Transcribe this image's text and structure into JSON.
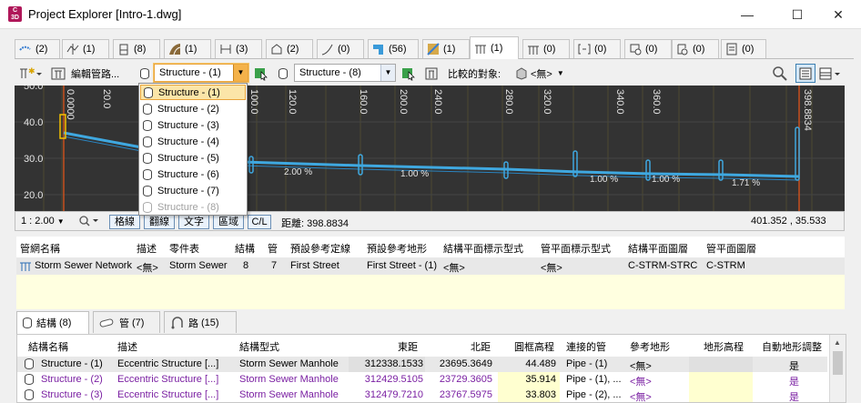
{
  "window": {
    "title": "Project Explorer [Intro-1.dwg]",
    "icon_text": "C3D"
  },
  "tabs": [
    {
      "count": "(2)",
      "icon": "alignment-icon"
    },
    {
      "count": "(1)",
      "icon": "profile-icon"
    },
    {
      "count": "(8)",
      "icon": "profile-view-icon"
    },
    {
      "count": "(1)",
      "icon": "corridor-icon"
    },
    {
      "count": "(3)",
      "icon": "sample-line-icon"
    },
    {
      "count": "(2)",
      "icon": "parcel-icon"
    },
    {
      "count": "(0)",
      "icon": "feature-line-icon"
    },
    {
      "count": "(56)",
      "icon": "pipe-icon"
    },
    {
      "count": "(1)",
      "icon": "surface-icon"
    },
    {
      "count": "(1)",
      "icon": "pipe-network-icon"
    },
    {
      "count": "(0)",
      "icon": "pressure-network-icon"
    },
    {
      "count": "(0)",
      "icon": "section-view-icon"
    },
    {
      "count": "(0)",
      "icon": "intersection-icon"
    },
    {
      "count": "(0)",
      "icon": "point-group-icon"
    },
    {
      "count": "(0)",
      "icon": "catchment-icon"
    }
  ],
  "toolbar": {
    "edit_label": "編輯管路...",
    "structure_combo": "Structure - (1)",
    "structure_combo2": "Structure - (8)",
    "compare_label": "比較的對象:",
    "compare_value": "<無>"
  },
  "dropdown_items": [
    "Structure - (1)",
    "Structure - (2)",
    "Structure - (3)",
    "Structure - (4)",
    "Structure - (5)",
    "Structure - (6)",
    "Structure - (7)",
    "Structure - (8)"
  ],
  "profile": {
    "y_labels": [
      "40.0",
      "30.0",
      "20.0"
    ],
    "top_partial_label": "50.0",
    "x_labels": [
      "0.0000",
      "20.0",
      "100.0",
      "120.0",
      "160.0",
      "200.0",
      "240.0",
      "280.0",
      "320.0",
      "340.0",
      "360.0",
      "398.8834"
    ],
    "grade_labels": [
      "2.00 %",
      "1.00 %",
      "1.00 %",
      "1.00 %",
      "1.71 %"
    ]
  },
  "status": {
    "scale": "1 : 2.00",
    "btn_grid": "格線",
    "btn_flip": "翻線",
    "btn_text": "文字",
    "btn_region": "區域",
    "btn_cl": "C/L",
    "distance": "距離: 398.8834",
    "coords": "401.352 , 35.533"
  },
  "network": {
    "headers": [
      "管網名稱",
      "描述",
      "零件表",
      "結構",
      "管",
      "預設參考定線",
      "預設參考地形",
      "結構平面標示型式",
      "管平面標示型式",
      "結構平面圖層",
      "管平面圖層"
    ],
    "row": [
      "Storm Sewer Network",
      "<無>",
      "Storm Sewer",
      "8",
      "7",
      "First Street",
      "First Street - (1)",
      "<無>",
      "<無>",
      "C-STRM-STRC",
      "C-STRM"
    ]
  },
  "bottom_tabs": [
    {
      "label": "結構",
      "count": "(8)",
      "icon": "structure-icon"
    },
    {
      "label": "管",
      "count": "(7)",
      "icon": "pipe-icon"
    },
    {
      "label": "路",
      "count": "(15)",
      "icon": "path-icon"
    }
  ],
  "structures": {
    "headers": [
      "結構名稱",
      "描述",
      "結構型式",
      "東距",
      "北距",
      "圓框高程",
      "連接的管",
      "參考地形",
      "地形高程",
      "自動地形調整"
    ],
    "rows": [
      [
        "Structure - (1)",
        "Eccentric Structure  [...]",
        "Storm Sewer Manhole",
        "312338.1533",
        "23695.3649",
        "44.489",
        "Pipe - (1)",
        "<無>",
        "",
        "是"
      ],
      [
        "Structure - (2)",
        "Eccentric Structure  [...]",
        "Storm Sewer Manhole",
        "312429.5105",
        "23729.3605",
        "35.914",
        "Pipe - (1), ...",
        "<無>",
        "",
        "是"
      ],
      [
        "Structure - (3)",
        "Eccentric Structure  [...]",
        "Storm Sewer Manhole",
        "312479.7210",
        "23767.5975",
        "33.803",
        "Pipe - (2), ...",
        "<無>",
        "",
        "是"
      ]
    ]
  },
  "colors": {
    "accent": "#3fa8e0",
    "highlight": "#fbe5a8",
    "purple": "#7a1fa2",
    "yellow_cell": "#ffffd0"
  }
}
